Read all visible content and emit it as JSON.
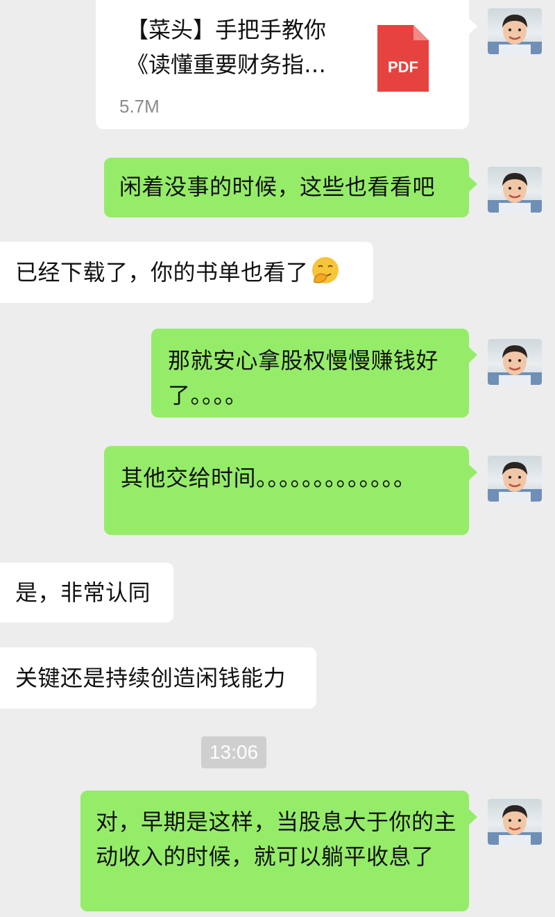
{
  "messages": [
    {
      "sender": "me",
      "type": "file",
      "title": "【菜头】手把手教你《读懂重要财务指…",
      "size": "5.7M",
      "file_type": "PDF"
    },
    {
      "sender": "me",
      "type": "text",
      "text": "闲着没事的时候，这些也看看吧"
    },
    {
      "sender": "them",
      "type": "text",
      "text": "已经下载了，你的书单也看了",
      "emoji": "smiling-face-with-hand-over-mouth"
    },
    {
      "sender": "me",
      "type": "text",
      "text": "那就安心拿股权慢慢赚钱好了。。。。"
    },
    {
      "sender": "me",
      "type": "text",
      "text": "其他交给时间。。。。。。。。。。。。。"
    },
    {
      "sender": "them",
      "type": "text",
      "text": "是，非常认同"
    },
    {
      "sender": "them",
      "type": "text",
      "text": "关键还是持续创造闲钱能力"
    },
    {
      "sender": "me",
      "type": "text",
      "text": "对，早期是这样，当股息大于你的主动收入的时候，就可以躺平收息了"
    }
  ],
  "timestamp": "13:06",
  "colors": {
    "background": "#ededed",
    "my_bubble": "#95ec69",
    "their_bubble": "#ffffff",
    "pdf_icon": "#e64340",
    "timestamp_bg": "#cfcfcf"
  }
}
